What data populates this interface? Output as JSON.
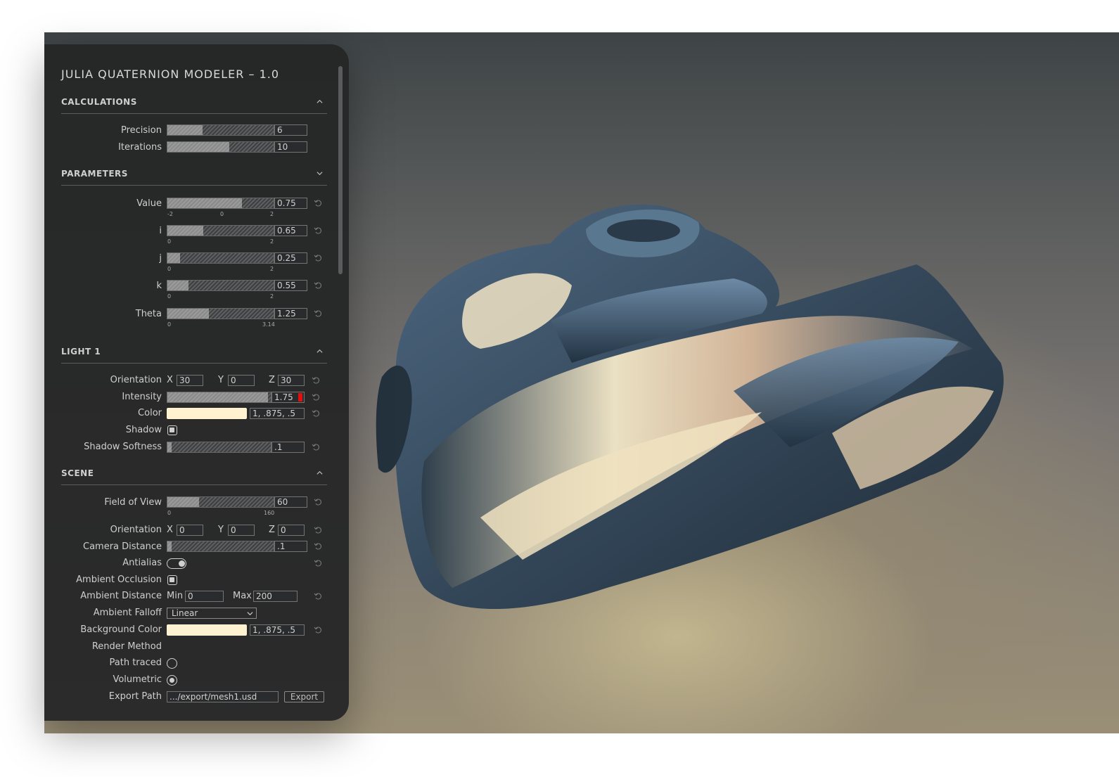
{
  "panel": {
    "title": "JULIA QUATERNION MODELER – 1.0"
  },
  "sections": {
    "calculations": {
      "title": "CALCULATIONS",
      "precision": {
        "label": "Precision",
        "value": "6",
        "fill": 0.33
      },
      "iterations": {
        "label": "Iterations",
        "value": "10",
        "fill": 0.58
      }
    },
    "parameters": {
      "title": "PARAMETERS",
      "value": {
        "label": "Value",
        "value": "0.75",
        "fill": 0.7,
        "ticks": [
          "-2",
          "0",
          "2"
        ]
      },
      "i": {
        "label": "i",
        "value": "0.65",
        "fill": 0.34,
        "ticks": [
          "0",
          "2"
        ]
      },
      "j": {
        "label": "j",
        "value": "0.25",
        "fill": 0.12,
        "ticks": [
          "0",
          "2"
        ]
      },
      "k": {
        "label": "k",
        "value": "0.55",
        "fill": 0.2,
        "ticks": [
          "0",
          "2"
        ]
      },
      "theta": {
        "label": "Theta",
        "value": "1.25",
        "fill": 0.39,
        "ticks": [
          "0",
          "3.14"
        ]
      }
    },
    "light1": {
      "title": "LIGHT 1",
      "orientation": {
        "label": "Orientation",
        "x_label": "X",
        "x": "30",
        "y_label": "Y",
        "y": "0",
        "z_label": "Z",
        "z": "30"
      },
      "intensity": {
        "label": "Intensity",
        "value": "1.75",
        "fill": 0.97
      },
      "color": {
        "label": "Color",
        "value": "1, .875, .5",
        "swatch": "#fff2d0"
      },
      "shadow": {
        "label": "Shadow",
        "checked": true
      },
      "shadow_softness": {
        "label": "Shadow Softness",
        "value": ".1",
        "fill": 0.04
      }
    },
    "scene": {
      "title": "SCENE",
      "fov": {
        "label": "Field of View",
        "value": "60",
        "fill": 0.3,
        "ticks": [
          "0",
          "160"
        ]
      },
      "orientation": {
        "label": "Orientation",
        "x_label": "X",
        "x": "0",
        "y_label": "Y",
        "y": "0",
        "z_label": "Z",
        "z": "0"
      },
      "camera_distance": {
        "label": "Camera Distance",
        "value": ".1",
        "fill": 0.04
      },
      "antialias": {
        "label": "Antialias",
        "on": true
      },
      "ambient_occlusion": {
        "label": "Ambient Occlusion",
        "checked": true
      },
      "ambient_distance": {
        "label": "Ambient Distance",
        "min_label": "Min",
        "min": "0",
        "max_label": "Max",
        "max": "200"
      },
      "ambient_falloff": {
        "label": "Ambient Falloff",
        "selected": "Linear"
      },
      "background_color": {
        "label": "Background Color",
        "value": "1, .875, .5",
        "swatch": "#fff2d0"
      },
      "render_method": {
        "label": "Render Method"
      },
      "path_traced": {
        "label": "Path traced",
        "selected": false
      },
      "volumetric": {
        "label": "Volumetric",
        "selected": true
      },
      "export_path": {
        "label": "Export Path",
        "value": ".../export/mesh1.usd",
        "button": "Export"
      }
    }
  },
  "colors": {
    "panel_bg": "#252627",
    "accent_red": "#e01010",
    "swatch": "#fff2d0"
  },
  "icons": [
    "chevron-up-icon",
    "chevron-down-icon",
    "reset-icon"
  ]
}
